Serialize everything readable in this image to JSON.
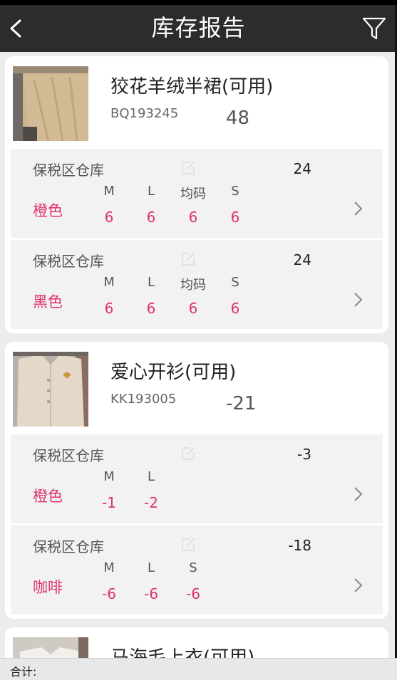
{
  "header": {
    "title": "库存报告"
  },
  "products": [
    {
      "name": "狡花羊绒半裙(可用)",
      "code": "BQ193245",
      "total": "48",
      "warehouses": [
        {
          "name": "保税区仓库",
          "total": "24",
          "color": "橙色",
          "sizes": [
            {
              "label": "M",
              "qty": "6"
            },
            {
              "label": "L",
              "qty": "6"
            },
            {
              "label": "均码",
              "qty": "6"
            },
            {
              "label": "S",
              "qty": "6"
            }
          ]
        },
        {
          "name": "保税区仓库",
          "total": "24",
          "color": "黑色",
          "sizes": [
            {
              "label": "M",
              "qty": "6"
            },
            {
              "label": "L",
              "qty": "6"
            },
            {
              "label": "均码",
              "qty": "6"
            },
            {
              "label": "S",
              "qty": "6"
            }
          ]
        }
      ]
    },
    {
      "name": "爱心开衫(可用)",
      "code": "KK193005",
      "total": "-21",
      "warehouses": [
        {
          "name": "保税区仓库",
          "total": "-3",
          "color": "橙色",
          "sizes": [
            {
              "label": "M",
              "qty": "-1"
            },
            {
              "label": "L",
              "qty": "-2"
            }
          ]
        },
        {
          "name": "保税区仓库",
          "total": "-18",
          "color": "咖啡",
          "sizes": [
            {
              "label": "M",
              "qty": "-6"
            },
            {
              "label": "L",
              "qty": "-6"
            },
            {
              "label": "S",
              "qty": "-6"
            }
          ]
        }
      ]
    },
    {
      "name": "马海毛上衣(可用)"
    }
  ],
  "footer": {
    "total_label": "合计:"
  },
  "colors": {
    "accent": "#e0336a",
    "header_bg": "#2c2c2c",
    "page_bg": "#ececec"
  }
}
